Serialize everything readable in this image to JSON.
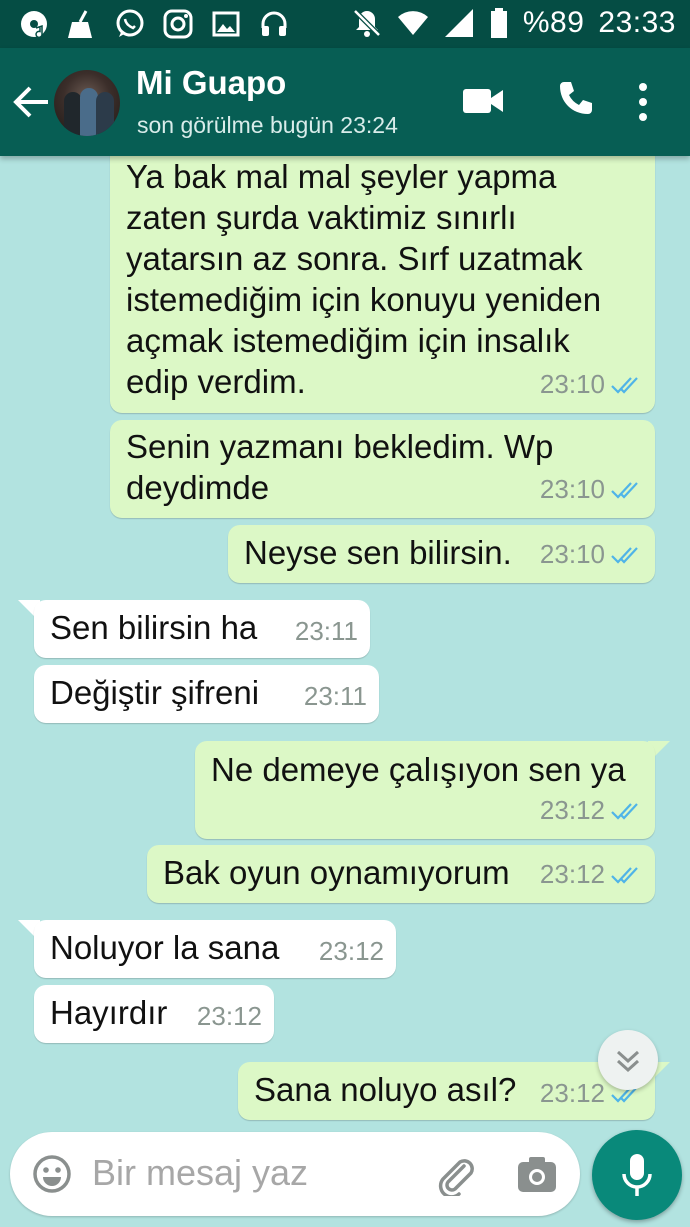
{
  "status_bar": {
    "battery": "%89",
    "time": "23:33"
  },
  "header": {
    "contact_name": "Mi Guapo",
    "last_seen": "son görülme bugün 23:24"
  },
  "messages": [
    {
      "dir": "out",
      "lines": [
        "Ya bak mal mal şeyler yapma",
        "zaten şurda vaktimiz sınırlı",
        "yatarsın az sonra. Sırf uzatmak",
        "istemediğim için konuyu yeniden",
        "açmak istemediğim için insalık",
        "edip verdim."
      ],
      "time": "23:10"
    },
    {
      "dir": "out",
      "lines": [
        "Senin yazmanı bekledim. Wp",
        "deydimde"
      ],
      "time": "23:10"
    },
    {
      "dir": "out",
      "lines": [
        "Neyse sen bilirsin."
      ],
      "time": "23:10"
    },
    {
      "dir": "in",
      "lines": [
        "Sen bilirsin ha"
      ],
      "time": "23:11"
    },
    {
      "dir": "in",
      "lines": [
        "Değiştir şifreni"
      ],
      "time": "23:11"
    },
    {
      "dir": "out",
      "lines": [
        "Ne demeye çalışıyon sen ya"
      ],
      "time": "23:12"
    },
    {
      "dir": "out",
      "lines": [
        "Bak oyun oynamıyorum"
      ],
      "time": "23:12"
    },
    {
      "dir": "in",
      "lines": [
        "Noluyor la sana"
      ],
      "time": "23:12"
    },
    {
      "dir": "in",
      "lines": [
        "Hayırdır"
      ],
      "time": "23:12"
    },
    {
      "dir": "out",
      "lines": [
        "Sana noluyo asıl?"
      ],
      "time": "23:12"
    }
  ],
  "composer": {
    "placeholder": "Bir mesaj yaz"
  },
  "icons": {
    "back": "arrow-left-icon",
    "video": "video-call-icon",
    "call": "phone-icon",
    "menu": "more-vert-icon",
    "emoji": "emoji-icon",
    "attach": "paperclip-icon",
    "camera": "camera-icon",
    "mic": "mic-icon",
    "scroll": "chevron-double-down-icon"
  },
  "colors": {
    "header": "#075e54",
    "status_bar": "#054d44",
    "chat_bg": "#b2e3e0",
    "outgoing": "#dcf8c6",
    "incoming": "#ffffff",
    "read_ticks": "#4fb4e8",
    "mic_button": "#09897a"
  }
}
